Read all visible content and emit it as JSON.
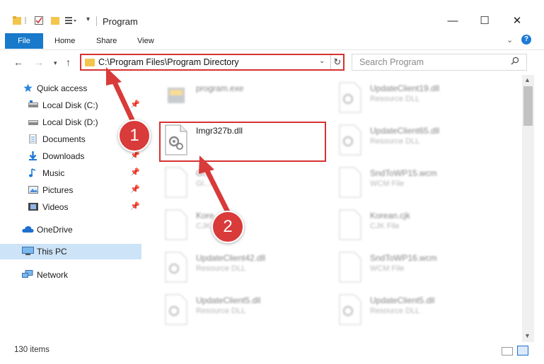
{
  "window": {
    "title": "Program",
    "controls": {
      "minimize": "—",
      "maximize": "☐",
      "close": "✕"
    }
  },
  "ribbon": {
    "file_tab": "File",
    "tabs": [
      "Home",
      "Share",
      "View"
    ],
    "help": "?"
  },
  "address": {
    "path": "C:\\Program Files\\Program Directory",
    "search_placeholder": "Search Program"
  },
  "nav_pane": {
    "items": [
      {
        "label": "Quick access",
        "icon": "star-icon"
      },
      {
        "label": "Local Disk (C:)",
        "icon": "drive-icon",
        "pinned": true
      },
      {
        "label": "Local Disk (D:)",
        "icon": "drive-icon"
      },
      {
        "label": "Documents",
        "icon": "documents-icon",
        "pinned": true
      },
      {
        "label": "Downloads",
        "icon": "downloads-icon",
        "pinned": true
      },
      {
        "label": "Music",
        "icon": "music-icon",
        "pinned": true
      },
      {
        "label": "Pictures",
        "icon": "pictures-icon",
        "pinned": true
      },
      {
        "label": "Videos",
        "icon": "videos-icon",
        "pinned": true
      },
      {
        "label": "OneDrive",
        "icon": "onedrive-icon"
      },
      {
        "label": "This PC",
        "icon": "computer-icon",
        "selected": true
      },
      {
        "label": "Network",
        "icon": "network-icon"
      }
    ]
  },
  "files": {
    "left": [
      {
        "name": "program.exe",
        "type": ""
      },
      {
        "name": "Imgr327b.dll",
        "type": ""
      },
      {
        "name": "Gl...",
        "type": "Gl...io"
      },
      {
        "name": "Kore...",
        "type": "CJK File"
      },
      {
        "name": "UpdateClient42.dll",
        "type": "Resource DLL"
      },
      {
        "name": "UpdateClient5.dll",
        "type": "Resource DLL"
      }
    ],
    "right": [
      {
        "name": "UpdateClient19.dll",
        "type": "Resource DLL"
      },
      {
        "name": "UpdateClient65.dll",
        "type": "Resource DLL"
      },
      {
        "name": "SndToWP15.wcm",
        "type": "WCM File"
      },
      {
        "name": "Korean.cjk",
        "type": "CJK File"
      },
      {
        "name": "SndToWP16.wcm",
        "type": "WCM File"
      },
      {
        "name": "UpdateClient5.dll",
        "type": "Resource DLL"
      }
    ]
  },
  "annotations": {
    "step1": "1",
    "step2": "2"
  },
  "status": {
    "item_count": "130 items"
  },
  "colors": {
    "accent": "#1979ca",
    "annotation": "#d93a3a",
    "selection": "#cde3f7"
  }
}
